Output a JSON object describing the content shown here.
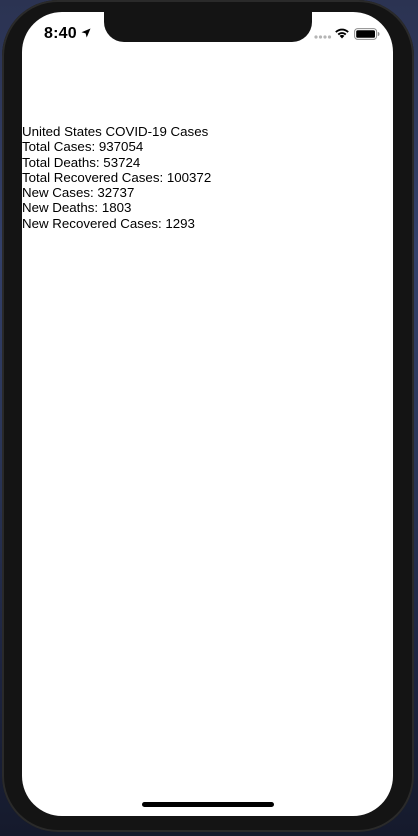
{
  "status_bar": {
    "time": "8:40"
  },
  "content": {
    "heading": "United States COVID-19 Cases",
    "lines": [
      "Total Cases: 937054",
      "Total Deaths: 53724",
      "Total Recovered Cases: 100372",
      "New Cases: 32737",
      "New Deaths: 1803",
      "New Recovered Cases: 1293"
    ]
  },
  "icons": {
    "location": "location-arrow-icon",
    "signal": "cellular-signal-icon",
    "wifi": "wifi-icon",
    "battery": "battery-icon"
  }
}
